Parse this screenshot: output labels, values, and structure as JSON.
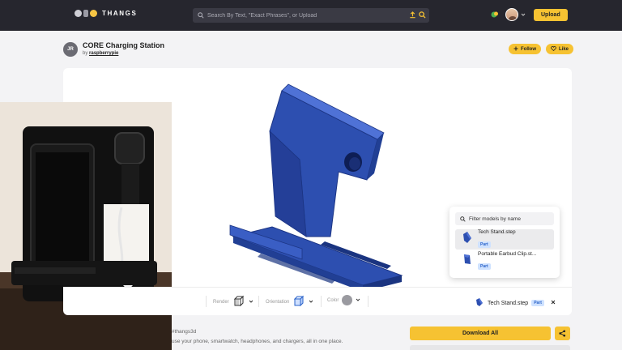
{
  "nav": {
    "logo_text": "THANGS",
    "search_placeholder": "Search By Text, \"Exact Phrases\", or Upload",
    "upload_label": "Upload"
  },
  "model": {
    "author_initials": "JR",
    "title": "CORE Charging Station",
    "by_prefix": "by",
    "author": "raspberrypie",
    "follow_label": "Follow",
    "like_label": "Like"
  },
  "toolbar": {
    "render_label": "Render",
    "orientation_label": "Orientation",
    "color_label": "Color",
    "selected_part_name": "Tech Stand.step",
    "selected_part_badge": "Part"
  },
  "filter_popup": {
    "placeholder": "Filter models by name",
    "items": [
      {
        "name": "Tech Stand.step",
        "badge": "Part",
        "selected": true
      },
      {
        "name": "Portable Earbud Clip.st...",
        "badge": "Part",
        "selected": false
      }
    ]
  },
  "description": {
    "tag_line": "#thangs3d",
    "text": "use your phone, smartwatch, headphones, and chargers, all in one place."
  },
  "actions": {
    "download_label": "Download All"
  },
  "colors": {
    "accent": "#f6c232",
    "nav_bg": "#26262e",
    "model_blue": "#2d4fb0"
  }
}
